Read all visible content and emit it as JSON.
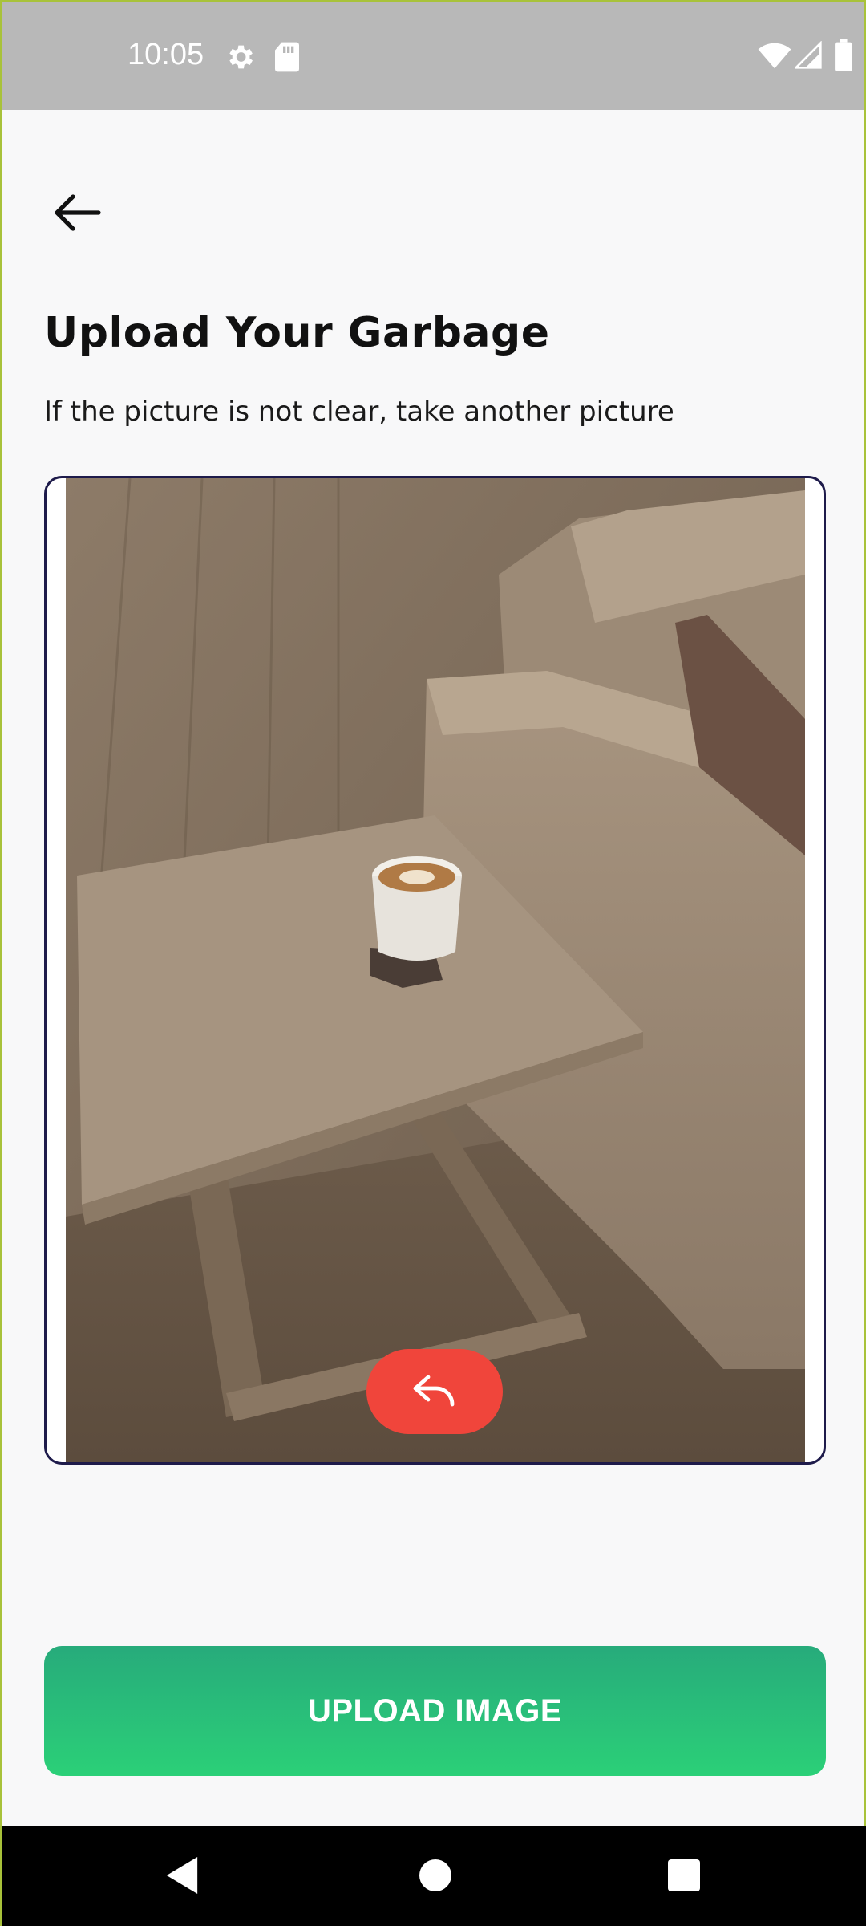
{
  "status_bar": {
    "time": "10:05",
    "icons_left": [
      "gear-icon",
      "sd-card-icon"
    ],
    "icons_right": [
      "wifi-icon",
      "signal-icon",
      "battery-icon"
    ]
  },
  "header": {
    "back_icon": "arrow-left-icon"
  },
  "main": {
    "title": "Upload Your Garbage",
    "subtitle": "If the picture is not clear, take another picture",
    "image_preview": {
      "retake_icon": "undo-arrow-icon"
    },
    "upload_button_label": "UPLOAD IMAGE"
  },
  "colors": {
    "accent_red": "#f0453b",
    "upload_green_top": "#27ab7b",
    "upload_green_bottom": "#2bd078",
    "frame_border": "#1e1b4b"
  },
  "nav_bar": {
    "icons": [
      "back-triangle-icon",
      "home-circle-icon",
      "recents-square-icon"
    ]
  }
}
